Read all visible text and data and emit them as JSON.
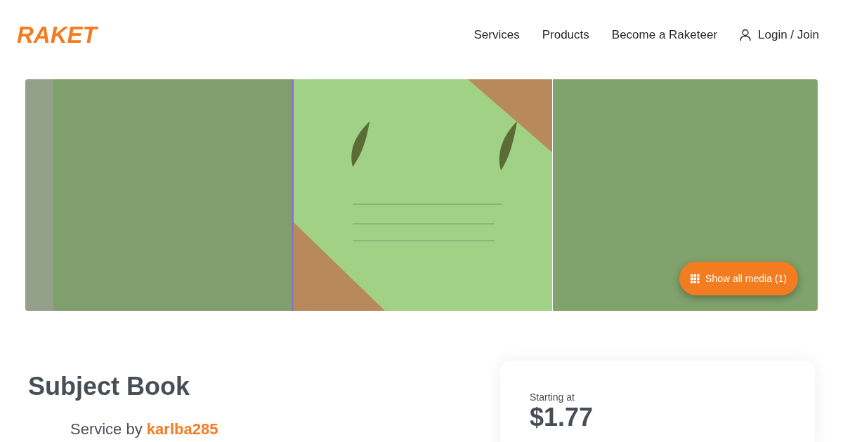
{
  "header": {
    "logo": "RAKET",
    "nav": [
      {
        "label": "Services",
        "kind": "link"
      },
      {
        "label": "Products",
        "kind": "link"
      },
      {
        "label": "Become a Raketeer",
        "kind": "link"
      },
      {
        "label": "Login / Join",
        "kind": "login"
      }
    ]
  },
  "gallery": {
    "button": "Show all media (1)"
  },
  "service": {
    "title": "Subject Book",
    "by_label": "Service by",
    "seller": "karlba285"
  },
  "pricing": {
    "label": "Starting at",
    "price": "$1.77"
  }
}
